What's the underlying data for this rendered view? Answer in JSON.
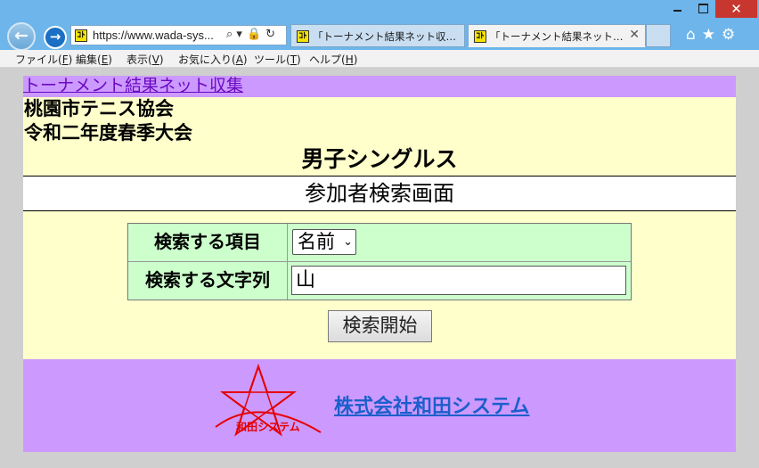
{
  "window": {
    "min_icon": "minimize-icon",
    "max_icon": "maximize-icon",
    "close_icon": "close-icon",
    "close_glyph": "✕"
  },
  "nav": {
    "back_glyph": "←",
    "forward_glyph": "→",
    "address": "https://www.wada-sys...",
    "address_icons": [
      "⌕ ▾",
      "🔒",
      "↻"
    ],
    "favicon_text": "ｺﾄ",
    "right_icons": [
      "⌂",
      "★",
      "⚙"
    ]
  },
  "tabs": [
    {
      "label": "「トーナメント結果ネット収集」トー..."
    },
    {
      "label": "「トーナメント結果ネット収集」...",
      "close": "✕"
    }
  ],
  "menu": [
    {
      "label": "ファイル(",
      "key": "F",
      "end": ")"
    },
    {
      "label": "編集(",
      "key": "E",
      "end": ")"
    },
    {
      "label": "表示(",
      "key": "V",
      "end": ")"
    },
    {
      "label": "お気に入り(",
      "key": "A",
      "end": ")"
    },
    {
      "label": "ツール(",
      "key": "T",
      "end": ")"
    },
    {
      "label": "ヘルプ(",
      "key": "H",
      "end": ")"
    }
  ],
  "page": {
    "site_link": "トーナメント結果ネット収集",
    "org": "桃園市テニス協会",
    "tournament": "令和二年度春季大会",
    "event": "男子シングルス",
    "screen_title": "参加者検索画面",
    "search_item_label": "検索する項目",
    "search_item_value": "名前",
    "caret": "⌄",
    "search_text_label": "検索する文字列",
    "search_text_value": "山",
    "search_button": "検索開始",
    "logo_text": "和田システム",
    "company": "株式会社和田システム"
  },
  "colors": {
    "header_band": "#cc99ff",
    "content_bg": "#ffffcc",
    "form_bg": "#ccffcc",
    "link": "#1c5fcb",
    "logo_red": "#e60000"
  }
}
